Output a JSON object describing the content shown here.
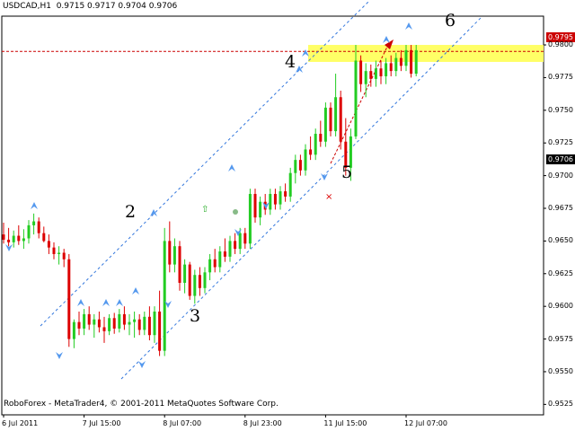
{
  "chart_data": {
    "type": "candlestick",
    "header": {
      "symbol": "USDCAD,H1",
      "ohlc": "0.9715 0.9717 0.9704 0.9706"
    },
    "copyright": "RoboForex - MetaTrader4, © 2001-2011 MetaQuotes Software Corp.",
    "yticks": [
      "0.9800",
      "0.9775",
      "0.9750",
      "0.9725",
      "0.9700",
      "0.9675",
      "0.9650",
      "0.9625",
      "0.9600",
      "0.9575",
      "0.9550",
      "0.9525"
    ],
    "ylim": [
      0.9517,
      0.9822
    ],
    "xticks": [
      {
        "label": "6 Jul 2011",
        "bar": 0
      },
      {
        "label": "7 Jul 15:00",
        "bar": 16
      },
      {
        "label": "8 Jul 07:00",
        "bar": 32
      },
      {
        "label": "8 Jul 23:00",
        "bar": 48
      },
      {
        "label": "11 Jul 15:00",
        "bar": 64
      },
      {
        "label": "12 Jul 07:00",
        "bar": 80
      }
    ],
    "bars": [
      [
        0.9655,
        0.9664,
        0.9648,
        0.9651
      ],
      [
        0.9651,
        0.966,
        0.9646,
        0.9649
      ],
      [
        0.9649,
        0.9658,
        0.9645,
        0.9654
      ],
      [
        0.9654,
        0.9662,
        0.9647,
        0.965
      ],
      [
        0.965,
        0.9659,
        0.9644,
        0.9652
      ],
      [
        0.9652,
        0.9666,
        0.9648,
        0.9662
      ],
      [
        0.9662,
        0.9671,
        0.9655,
        0.9665
      ],
      [
        0.9665,
        0.9668,
        0.9652,
        0.9656
      ],
      [
        0.9656,
        0.9661,
        0.9649,
        0.965
      ],
      [
        0.965,
        0.9655,
        0.964,
        0.9645
      ],
      [
        0.9645,
        0.9649,
        0.9636,
        0.964
      ],
      [
        0.964,
        0.9646,
        0.9632,
        0.9641
      ],
      [
        0.9641,
        0.9644,
        0.963,
        0.9636
      ],
      [
        0.9636,
        0.964,
        0.9569,
        0.9575
      ],
      [
        0.9575,
        0.959,
        0.9568,
        0.9588
      ],
      [
        0.9588,
        0.9596,
        0.9578,
        0.9583
      ],
      [
        0.9583,
        0.9598,
        0.9578,
        0.9594
      ],
      [
        0.9594,
        0.96,
        0.9582,
        0.9586
      ],
      [
        0.9586,
        0.9594,
        0.9576,
        0.959
      ],
      [
        0.959,
        0.9596,
        0.958,
        0.9584
      ],
      [
        0.9584,
        0.9592,
        0.9572,
        0.9581
      ],
      [
        0.9581,
        0.9594,
        0.9578,
        0.9591
      ],
      [
        0.9591,
        0.9595,
        0.9579,
        0.9583
      ],
      [
        0.9583,
        0.9598,
        0.958,
        0.9594
      ],
      [
        0.9594,
        0.96,
        0.9582,
        0.9586
      ],
      [
        0.9586,
        0.9594,
        0.9578,
        0.9588
      ],
      [
        0.9588,
        0.9596,
        0.9576,
        0.959
      ],
      [
        0.959,
        0.9594,
        0.9578,
        0.9582
      ],
      [
        0.9582,
        0.9596,
        0.9578,
        0.9592
      ],
      [
        0.9592,
        0.96,
        0.9574,
        0.9578
      ],
      [
        0.9578,
        0.96,
        0.9572,
        0.9596
      ],
      [
        0.9596,
        0.9612,
        0.9562,
        0.9566
      ],
      [
        0.9566,
        0.966,
        0.9562,
        0.965
      ],
      [
        0.965,
        0.9665,
        0.9626,
        0.9632
      ],
      [
        0.9632,
        0.9652,
        0.9626,
        0.9646
      ],
      [
        0.9646,
        0.965,
        0.9612,
        0.9618
      ],
      [
        0.9618,
        0.9636,
        0.961,
        0.9632
      ],
      [
        0.9632,
        0.9634,
        0.9605,
        0.9608
      ],
      [
        0.9608,
        0.9628,
        0.9602,
        0.9624
      ],
      [
        0.9624,
        0.963,
        0.9608,
        0.9614
      ],
      [
        0.9614,
        0.963,
        0.961,
        0.9626
      ],
      [
        0.9626,
        0.964,
        0.962,
        0.9636
      ],
      [
        0.9636,
        0.9644,
        0.9626,
        0.963
      ],
      [
        0.963,
        0.9646,
        0.9626,
        0.9642
      ],
      [
        0.9642,
        0.9652,
        0.9634,
        0.9638
      ],
      [
        0.9638,
        0.9654,
        0.9634,
        0.965
      ],
      [
        0.965,
        0.9656,
        0.964,
        0.9644
      ],
      [
        0.9644,
        0.966,
        0.964,
        0.9656
      ],
      [
        0.9656,
        0.966,
        0.9644,
        0.9648
      ],
      [
        0.9648,
        0.969,
        0.9644,
        0.9686
      ],
      [
        0.9686,
        0.969,
        0.9664,
        0.9668
      ],
      [
        0.9668,
        0.9684,
        0.9662,
        0.968
      ],
      [
        0.968,
        0.9686,
        0.967,
        0.9674
      ],
      [
        0.9674,
        0.969,
        0.967,
        0.9686
      ],
      [
        0.9686,
        0.969,
        0.9674,
        0.9678
      ],
      [
        0.9678,
        0.9692,
        0.9674,
        0.9688
      ],
      [
        0.9688,
        0.9694,
        0.968,
        0.9684
      ],
      [
        0.9684,
        0.9706,
        0.968,
        0.9702
      ],
      [
        0.9702,
        0.9716,
        0.9694,
        0.9712
      ],
      [
        0.9712,
        0.9716,
        0.97,
        0.9704
      ],
      [
        0.9704,
        0.9724,
        0.97,
        0.972
      ],
      [
        0.972,
        0.973,
        0.9712,
        0.9716
      ],
      [
        0.9716,
        0.9736,
        0.9712,
        0.9732
      ],
      [
        0.9732,
        0.9742,
        0.9722,
        0.9726
      ],
      [
        0.9726,
        0.9756,
        0.9722,
        0.9752
      ],
      [
        0.9752,
        0.9756,
        0.973,
        0.9734
      ],
      [
        0.9734,
        0.9778,
        0.973,
        0.976
      ],
      [
        0.976,
        0.9765,
        0.972,
        0.9726
      ],
      [
        0.9726,
        0.9744,
        0.97,
        0.9706
      ],
      [
        0.9706,
        0.9736,
        0.9696,
        0.973
      ],
      [
        0.973,
        0.98,
        0.9728,
        0.9788
      ],
      [
        0.9788,
        0.9792,
        0.9764,
        0.977
      ],
      [
        0.977,
        0.9786,
        0.976,
        0.978
      ],
      [
        0.978,
        0.9785,
        0.9768,
        0.9774
      ],
      [
        0.9774,
        0.9788,
        0.9768,
        0.9782
      ],
      [
        0.9782,
        0.9788,
        0.977,
        0.9776
      ],
      [
        0.9776,
        0.979,
        0.977,
        0.9786
      ],
      [
        0.9786,
        0.9792,
        0.9776,
        0.978
      ],
      [
        0.978,
        0.9794,
        0.9776,
        0.979
      ],
      [
        0.979,
        0.9796,
        0.978,
        0.9784
      ],
      [
        0.9784,
        0.98,
        0.978,
        0.9796
      ],
      [
        0.9796,
        0.98,
        0.9775,
        0.9778
      ],
      [
        0.9778,
        0.98,
        0.9776,
        0.9796
      ]
    ],
    "target_zone": [
      0.9787,
      0.98
    ],
    "resistance_line": 0.9795,
    "price_labels": {
      "resistance": "0.9795",
      "current": "0.9706"
    },
    "pattern_labels": [
      "2",
      "3",
      "4",
      "5",
      "6"
    ],
    "colors": {
      "bull": "#22cc22",
      "bear": "#dd0000",
      "zone": "#ffff66",
      "channel": "#3377dd",
      "fractal": "#5599ee",
      "resistance": "#cc0000"
    }
  }
}
